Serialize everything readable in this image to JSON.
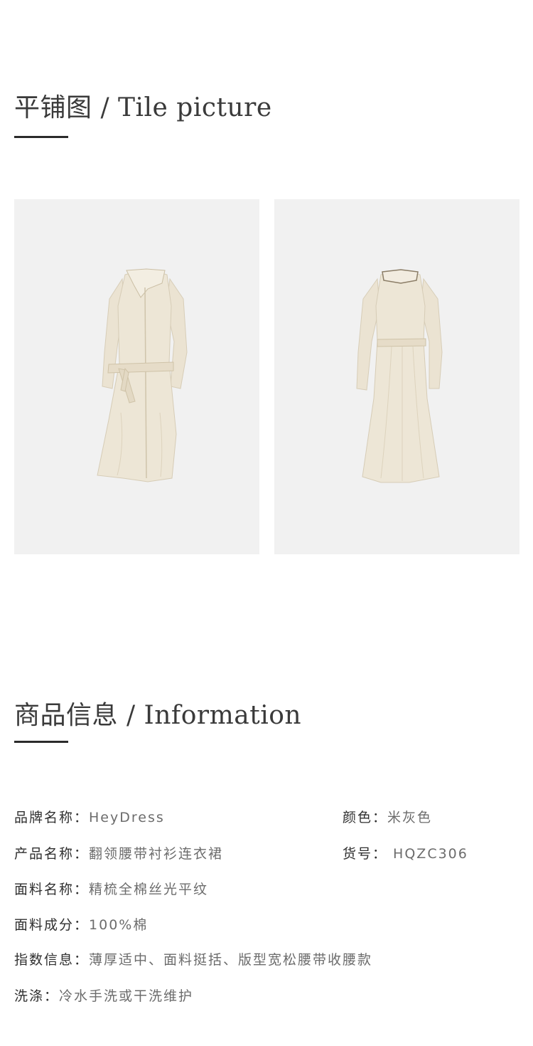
{
  "tile_section": {
    "title": "平铺图 / Tile picture",
    "images": [
      {
        "icon": "dress-front-image"
      },
      {
        "icon": "dress-back-image"
      }
    ],
    "dress_color": "#ede6d6"
  },
  "info_section": {
    "title": "商品信息 / Information",
    "rows": [
      {
        "label": "品牌名称：",
        "value": "HeyDress"
      },
      {
        "label": "颜色：",
        "value": "米灰色"
      },
      {
        "label": "产品名称：",
        "value": "翻领腰带衬衫连衣裙"
      },
      {
        "label": "货号：",
        "value": " HQZC306"
      },
      {
        "label": "面料名称：",
        "value": "精梳全棉丝光平纹"
      },
      {
        "label": "面料成分：",
        "value": "100%棉"
      },
      {
        "label": "指数信息：",
        "value": "薄厚适中、面料挺括、版型宽松腰带收腰款"
      },
      {
        "label": "洗涤：",
        "value": "冷水手洗或干洗维护"
      }
    ]
  }
}
